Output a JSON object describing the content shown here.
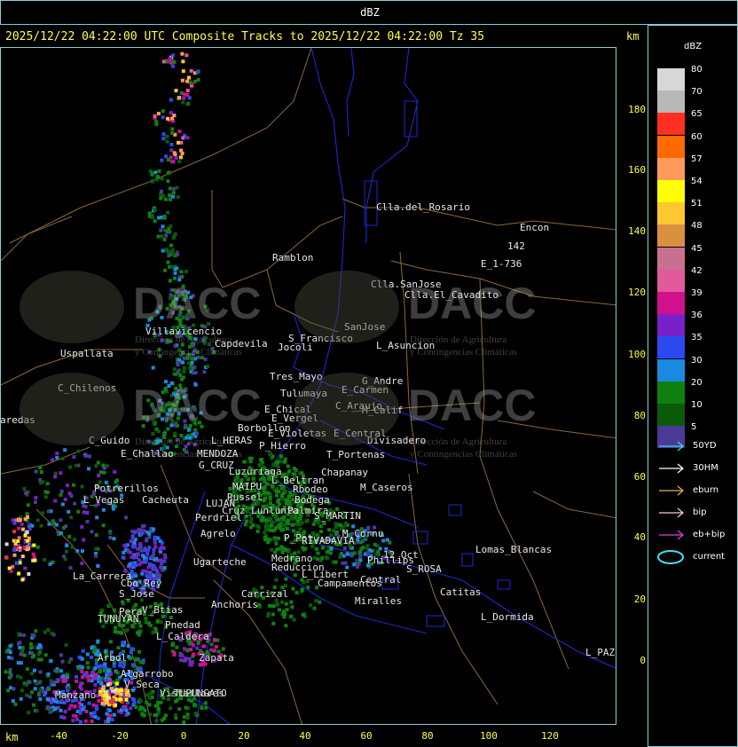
{
  "window": {
    "title": "dBZ"
  },
  "header": {
    "text": "2025/12/22 04:22:00 UTC Composite Tracks to 2025/12/22 04:22:00 Tz 35",
    "unit_right": "km"
  },
  "axes": {
    "x_label": "km",
    "x_ticks": [
      "-40",
      "-20",
      "0",
      "20",
      "40",
      "60",
      "80",
      "100",
      "120"
    ],
    "y_ticks": [
      "180",
      "160",
      "140",
      "120",
      "100",
      "80",
      "60",
      "40",
      "20",
      "0"
    ]
  },
  "legend": {
    "title": "dBZ",
    "items": [
      {
        "value": "80",
        "color": "#d8d8d8"
      },
      {
        "value": "70",
        "color": "#b8b8b8"
      },
      {
        "value": "65",
        "color": "#ff3020"
      },
      {
        "value": "60",
        "color": "#ff6a00"
      },
      {
        "value": "57",
        "color": "#ff9a5a"
      },
      {
        "value": "54",
        "color": "#ffff00"
      },
      {
        "value": "51",
        "color": "#ffc830"
      },
      {
        "value": "48",
        "color": "#d99040"
      },
      {
        "value": "45",
        "color": "#c87090"
      },
      {
        "value": "42",
        "color": "#e05a9c"
      },
      {
        "value": "39",
        "color": "#d0108c"
      },
      {
        "value": "36",
        "color": "#7a20c8"
      },
      {
        "value": "35",
        "color": "#2a4af0"
      },
      {
        "value": "30",
        "color": "#1a8ae0"
      },
      {
        "value": "20",
        "color": "#108010"
      },
      {
        "value": "10",
        "color": "#0a5a0a"
      },
      {
        "value": "5",
        "color": "#4a3a98"
      }
    ]
  },
  "track_symbols": [
    {
      "label": "50YD",
      "color": "#40d8e0"
    },
    {
      "label": "30HM",
      "color": "#ffffff"
    },
    {
      "label": "eburn",
      "color": "#e0b070"
    },
    {
      "label": "bip",
      "color": "#ffc8d8"
    },
    {
      "label": "eb+bip",
      "color": "#e040e0"
    },
    {
      "label": "current",
      "color": "#40e0f0"
    }
  ],
  "places": [
    {
      "name": "Clla.del_Rosario"
    },
    {
      "name": "Encon"
    },
    {
      "name": "142"
    },
    {
      "name": "E_1-736"
    },
    {
      "name": "Ramblon"
    },
    {
      "name": "Clla.SanJose"
    },
    {
      "name": "Clla.El_Cavadito"
    },
    {
      "name": "Villavicencio"
    },
    {
      "name": "Capdevila"
    },
    {
      "name": "S_Francisco"
    },
    {
      "name": "Jocoli"
    },
    {
      "name": "SanJose"
    },
    {
      "name": "L_Asuncion"
    },
    {
      "name": "Uspallata"
    },
    {
      "name": "Tres_Mayo"
    },
    {
      "name": "G_Andre"
    },
    {
      "name": "E_Carmen"
    },
    {
      "name": "Tulumaya"
    },
    {
      "name": "C_Chilenos"
    },
    {
      "name": "C_Araujo"
    },
    {
      "name": "M_Calif"
    },
    {
      "name": "E_Chical"
    },
    {
      "name": "E_Vergel"
    },
    {
      "name": "aredas"
    },
    {
      "name": "Borbollon"
    },
    {
      "name": "E_Violetas"
    },
    {
      "name": "E_Central"
    },
    {
      "name": "Divisadero"
    },
    {
      "name": "C_Guido"
    },
    {
      "name": "L_HERAS"
    },
    {
      "name": "P_Hierro"
    },
    {
      "name": "E_Challao"
    },
    {
      "name": "MENDOZA"
    },
    {
      "name": "T_Portenas"
    },
    {
      "name": "G_CRUZ"
    },
    {
      "name": "Luzuriaga"
    },
    {
      "name": "Chapanay"
    },
    {
      "name": "L_Beltran"
    },
    {
      "name": "Rbodeo"
    },
    {
      "name": "M_Caseros"
    },
    {
      "name": "Potrerillos"
    },
    {
      "name": "MAIPU"
    },
    {
      "name": "L_Vegas"
    },
    {
      "name": "Cacheuta"
    },
    {
      "name": "Russel"
    },
    {
      "name": "Bodega"
    },
    {
      "name": "LUJAN"
    },
    {
      "name": "Cruz_Lunlunta"
    },
    {
      "name": "Palmira"
    },
    {
      "name": "S_MARTIN"
    },
    {
      "name": "Perdriel"
    },
    {
      "name": "Agrelo"
    },
    {
      "name": "M_Cornu"
    },
    {
      "name": "P_Pat..."
    },
    {
      "name": "RIVADAVIA"
    },
    {
      "name": "Lomas_Blancas"
    },
    {
      "name": "12_Oct"
    },
    {
      "name": "Ugarteche"
    },
    {
      "name": "Medrano"
    },
    {
      "name": "Phillips"
    },
    {
      "name": "Reduccion"
    },
    {
      "name": "S_ROSA"
    },
    {
      "name": "La_Carrera"
    },
    {
      "name": "Cbo_Rey"
    },
    {
      "name": "L_Libert"
    },
    {
      "name": "Central"
    },
    {
      "name": "S_Jose"
    },
    {
      "name": "Campamentos"
    },
    {
      "name": "Catitas"
    },
    {
      "name": "Carrizal"
    },
    {
      "name": "Miralles"
    },
    {
      "name": "Anchoris"
    },
    {
      "name": "V_Btias"
    },
    {
      "name": "Pera"
    },
    {
      "name": "TUNUYAN"
    },
    {
      "name": "L_Dormida"
    },
    {
      "name": "Pnedad"
    },
    {
      "name": "L_Caldera"
    },
    {
      "name": "Zapata"
    },
    {
      "name": "Arbol"
    },
    {
      "name": "L_PAZ"
    },
    {
      "name": "Algarrobo"
    },
    {
      "name": "V_Seca"
    },
    {
      "name": "Vistaflores"
    },
    {
      "name": "Manzano"
    },
    {
      "name": "TUPUNGATO"
    }
  ],
  "watermarks": [
    {
      "brand": "DACC",
      "sub1": "Dirección de Agricultura",
      "sub2": "y Contingencias Climáticas"
    },
    {
      "brand": "DACC",
      "sub1": "Dirección de Agricultura",
      "sub2": "y Contingencias Climáticas"
    },
    {
      "brand": "DACC",
      "sub1": "Dirección de Agricultura",
      "sub2": "y Contingencias Climáticas"
    },
    {
      "brand": "DACC",
      "sub1": "Dirección de Agricultura",
      "sub2": "y Contingencias Climáticas"
    }
  ]
}
